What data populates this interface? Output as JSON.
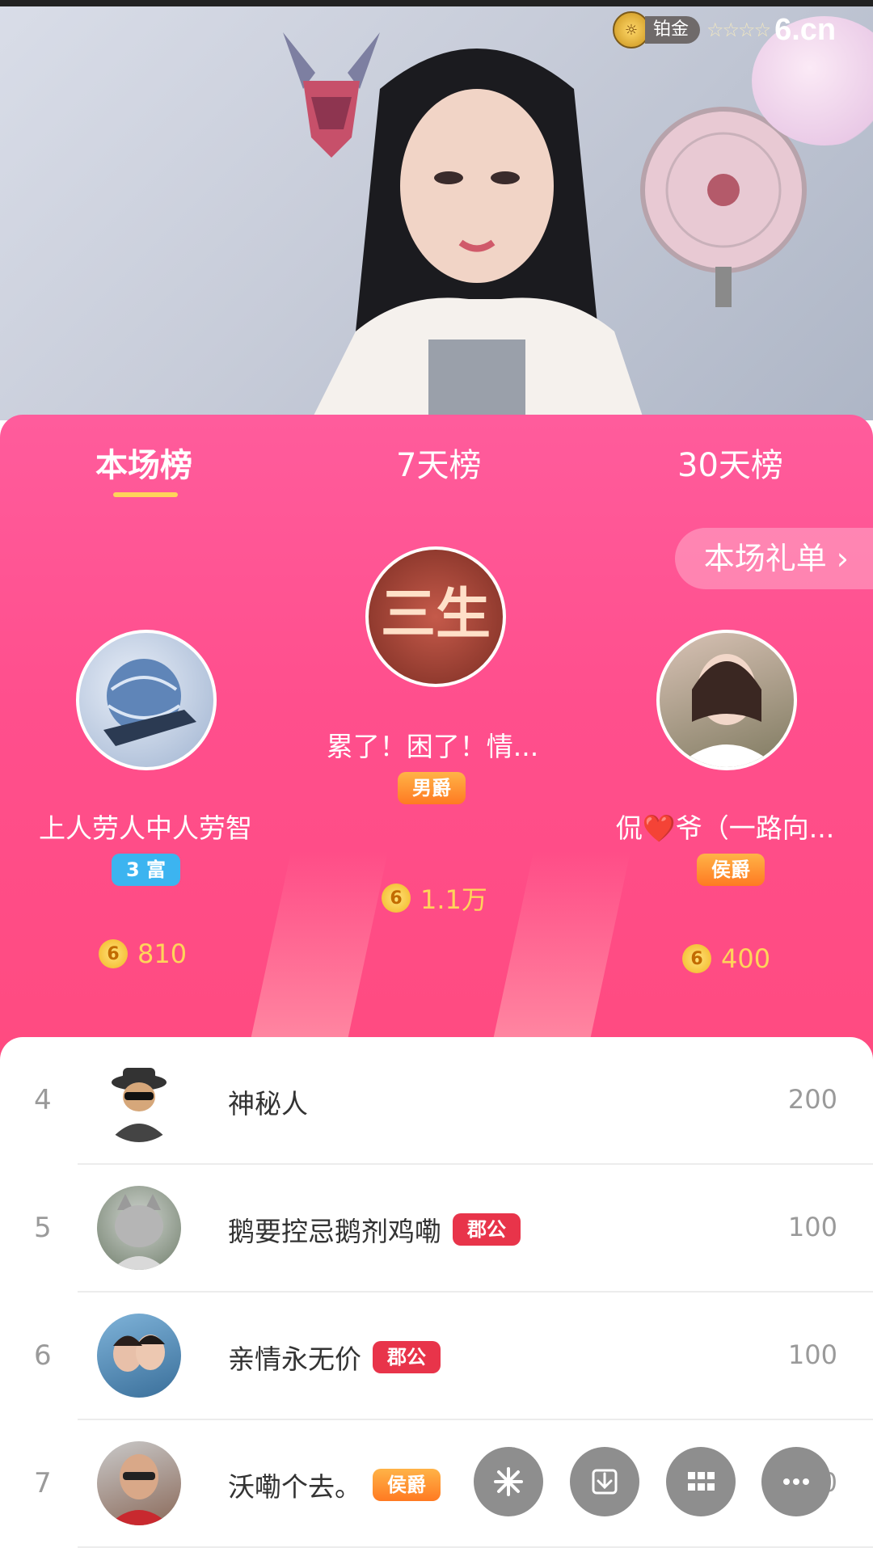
{
  "video": {
    "level_label": "铂金",
    "stars": "☆☆☆☆",
    "brand": "6.cn"
  },
  "tabs": [
    {
      "label": "本场榜",
      "active": true
    },
    {
      "label": "7天榜",
      "active": false
    },
    {
      "label": "30天榜",
      "active": false
    }
  ],
  "gift_list_button": "本场礼单 ›",
  "podium": {
    "first": {
      "name": "累了！困了！情...",
      "badge": "男爵",
      "coins": "1.1万",
      "avatar_text": "三生"
    },
    "second": {
      "name": "上人劳人中人劳智",
      "badge": "3 富",
      "coins": "810"
    },
    "third": {
      "name": "侃❤️爷（一路向...",
      "badge": "侯爵",
      "coins": "400"
    }
  },
  "list": [
    {
      "rank": "4",
      "name": "神秘人",
      "badge": "",
      "score": "200"
    },
    {
      "rank": "5",
      "name": "鹅要控忌鹅剂鸡嘞",
      "badge": "郡公",
      "score": "100"
    },
    {
      "rank": "6",
      "name": "亲情永无价",
      "badge": "郡公",
      "score": "100"
    },
    {
      "rank": "7",
      "name": "沃嘞个去。",
      "badge": "侯爵",
      "score": "20"
    }
  ],
  "coin_symbol": "6",
  "colors": {
    "panel": "#ff4f8d",
    "gold": "#ffd45a",
    "badge_blue": "#3cb4f0",
    "badge_orange": "#ff7a22",
    "badge_red": "#e8344a"
  }
}
